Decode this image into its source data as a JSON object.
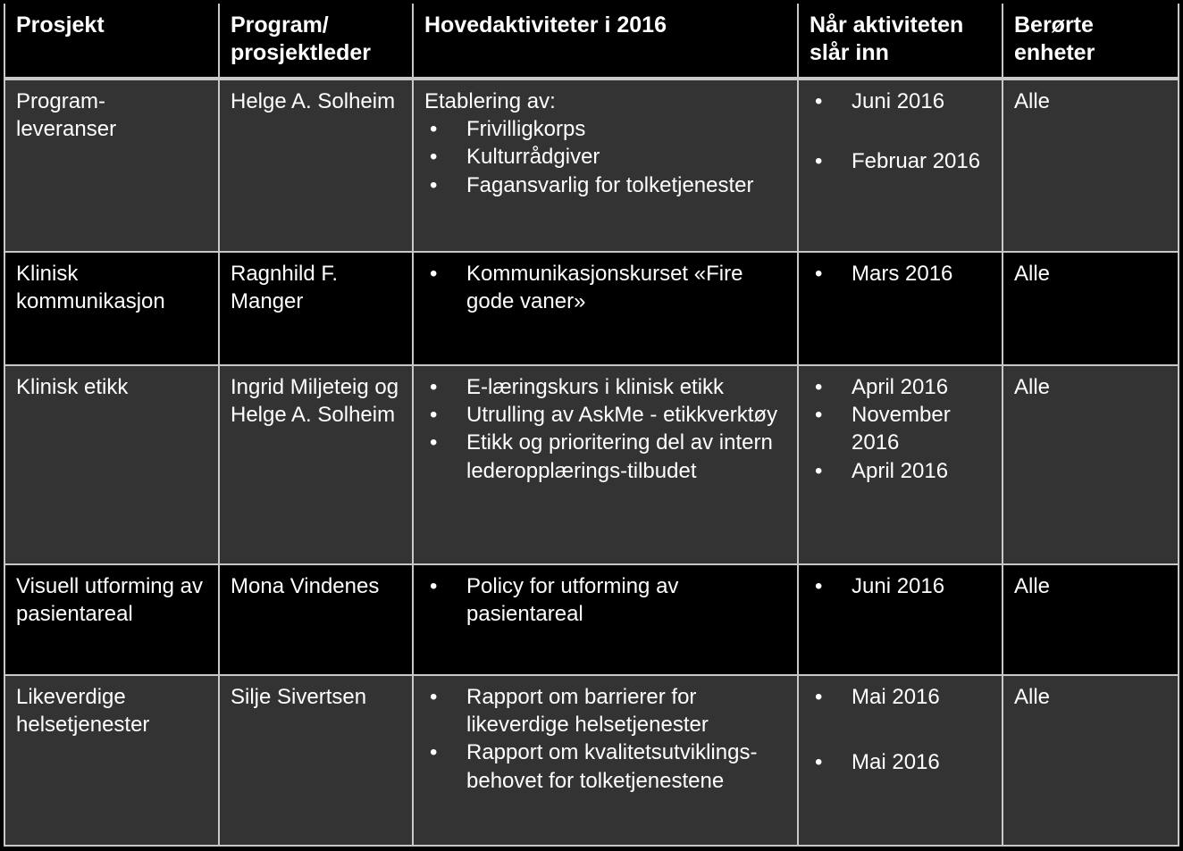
{
  "table": {
    "columns": [
      {
        "id": "prosjekt",
        "label": "Prosjekt"
      },
      {
        "id": "leder",
        "label": "Program/\nprosjektleder"
      },
      {
        "id": "hovedaktiviteter",
        "label": "Hovedaktiviteter i 2016"
      },
      {
        "id": "naar",
        "label": "Når aktiviteten slår inn"
      },
      {
        "id": "enheter",
        "label": "Berørte enheter"
      }
    ],
    "rows": [
      {
        "prosjekt": "Program-\nleveranser",
        "leder": "Helge A. Solheim",
        "aktiviteter_lead": "Etablering av:",
        "aktiviteter": [
          "Frivilligkorps",
          "Kulturrådgiver",
          "Fagansvarlig for tolketjenester"
        ],
        "naar": [
          "Juni 2016",
          "Februar 2016"
        ],
        "enheter": "Alle"
      },
      {
        "prosjekt": "Klinisk kommunikasjon",
        "leder": "Ragnhild F. Manger",
        "aktiviteter_lead": "",
        "aktiviteter": [
          "Kommunikasjonskurset «Fire gode vaner»"
        ],
        "naar": [
          "Mars 2016"
        ],
        "enheter": "Alle"
      },
      {
        "prosjekt": "Klinisk etikk",
        "leder": "Ingrid Miljeteig og Helge A. Solheim",
        "aktiviteter_lead": "",
        "aktiviteter": [
          "E-læringskurs i klinisk etikk",
          "Utrulling av AskMe - etikkverktøy",
          "Etikk og prioritering del av intern lederopplærings-tilbudet"
        ],
        "naar": [
          "April 2016",
          "November 2016",
          "April 2016"
        ],
        "enheter": "Alle"
      },
      {
        "prosjekt": "Visuell utforming av pasientareal",
        "leder": "Mona Vindenes",
        "aktiviteter_lead": "",
        "aktiviteter": [
          "Policy for utforming av pasientareal"
        ],
        "naar": [
          "Juni 2016"
        ],
        "enheter": "Alle"
      },
      {
        "prosjekt": "Likeverdige helsetjenester",
        "leder": "Silje Sivertsen",
        "aktiviteter_lead": "",
        "aktiviteter": [
          "Rapport om barrierer for likeverdige helsetjenester",
          "Rapport om kvalitetsutviklings-behovet for tolketjenestene"
        ],
        "naar": [
          "Mai 2016",
          "Mai 2016"
        ],
        "enheter": "Alle"
      }
    ]
  },
  "colors": {
    "page_background": "#000000",
    "header_background": "#000000",
    "row_shaded_background": "#333333",
    "row_dark_background": "#000000",
    "border": "#c8c8c8",
    "text": "#ffffff"
  }
}
